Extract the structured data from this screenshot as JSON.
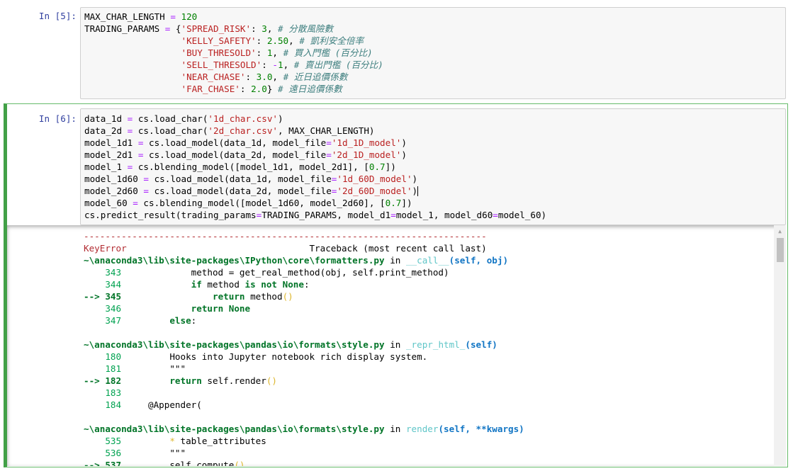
{
  "cells": [
    {
      "prompt": "In [5]:",
      "lines": [
        [
          [
            "",
            "MAX_CHAR_LENGTH "
          ],
          [
            "op",
            "="
          ],
          [
            "num",
            " 120"
          ]
        ],
        [
          [
            "",
            "TRADING_PARAMS "
          ],
          [
            "op",
            "="
          ],
          [
            "",
            " {"
          ],
          [
            "str",
            "'SPREAD_RISK'"
          ],
          [
            "",
            ": "
          ],
          [
            "num",
            "3"
          ],
          [
            "",
            ", "
          ],
          [
            "cmt",
            "# 分散風險數"
          ]
        ],
        [
          [
            "",
            "                  "
          ],
          [
            "str",
            "'KELLY_SAFETY'"
          ],
          [
            "",
            ": "
          ],
          [
            "num",
            "2.50"
          ],
          [
            "",
            ", "
          ],
          [
            "cmt",
            "# 凱利安全倍率"
          ]
        ],
        [
          [
            "",
            "                  "
          ],
          [
            "str",
            "'BUY_THRESOLD'"
          ],
          [
            "",
            ": "
          ],
          [
            "num",
            "1"
          ],
          [
            "",
            ", "
          ],
          [
            "cmt",
            "# 買入門檻 (百分比)"
          ]
        ],
        [
          [
            "",
            "                  "
          ],
          [
            "str",
            "'SELL_THRESOLD'"
          ],
          [
            "",
            ": "
          ],
          [
            "op",
            "-"
          ],
          [
            "num",
            "1"
          ],
          [
            "",
            ", "
          ],
          [
            "cmt",
            "# 賣出門檻 (百分比)"
          ]
        ],
        [
          [
            "",
            "                  "
          ],
          [
            "str",
            "'NEAR_CHASE'"
          ],
          [
            "",
            ": "
          ],
          [
            "num",
            "3.0"
          ],
          [
            "",
            ", "
          ],
          [
            "cmt",
            "# 近日追價係數"
          ]
        ],
        [
          [
            "",
            "                  "
          ],
          [
            "str",
            "'FAR_CHASE'"
          ],
          [
            "",
            ": "
          ],
          [
            "num",
            "2.0"
          ],
          [
            "",
            "} "
          ],
          [
            "cmt",
            "# 遠日追價係數"
          ]
        ]
      ]
    },
    {
      "prompt": "In [6]:",
      "lines": [
        [
          [
            "",
            "data_1d "
          ],
          [
            "op",
            "="
          ],
          [
            "",
            " cs.load_char("
          ],
          [
            "str",
            "'1d_char.csv'"
          ],
          [
            "",
            ")"
          ]
        ],
        [
          [
            "",
            "data_2d "
          ],
          [
            "op",
            "="
          ],
          [
            "",
            " cs.load_char("
          ],
          [
            "str",
            "'2d_char.csv'"
          ],
          [
            "",
            ", MAX_CHAR_LENGTH)"
          ]
        ],
        [
          [
            "",
            "model_1d1 "
          ],
          [
            "op",
            "="
          ],
          [
            "",
            " cs.load_model(data_1d, model_file"
          ],
          [
            "op",
            "="
          ],
          [
            "str",
            "'1d_1D_model'"
          ],
          [
            "",
            ")"
          ]
        ],
        [
          [
            "",
            "model_2d1 "
          ],
          [
            "op",
            "="
          ],
          [
            "",
            " cs.load_model(data_2d, model_file"
          ],
          [
            "op",
            "="
          ],
          [
            "str",
            "'2d_1D_model'"
          ],
          [
            "",
            ")"
          ]
        ],
        [
          [
            "",
            "model_1 "
          ],
          [
            "op",
            "="
          ],
          [
            "",
            " cs.blending_model([model_1d1, model_2d1], ["
          ],
          [
            "num",
            "0.7"
          ],
          [
            "",
            "])"
          ]
        ],
        [
          [
            "",
            "model_1d60 "
          ],
          [
            "op",
            "="
          ],
          [
            "",
            " cs.load_model(data_1d, model_file"
          ],
          [
            "op",
            "="
          ],
          [
            "str",
            "'1d_60D_model'"
          ],
          [
            "",
            ")"
          ]
        ],
        [
          [
            "",
            "model_2d60 "
          ],
          [
            "op",
            "="
          ],
          [
            "",
            " cs.load_model(data_2d, model_file"
          ],
          [
            "op",
            "="
          ],
          [
            "str",
            "'2d_60D_model'"
          ],
          [
            "",
            ")"
          ],
          [
            "cursor",
            ""
          ]
        ],
        [
          [
            "",
            "model_60 "
          ],
          [
            "op",
            "="
          ],
          [
            "",
            " cs.blending_model([model_1d60, model_2d60], ["
          ],
          [
            "num",
            "0.7"
          ],
          [
            "",
            "])"
          ]
        ],
        [
          [
            "",
            "cs.predict_result(trading_params"
          ],
          [
            "op",
            "="
          ],
          [
            "",
            "TRADING_PARAMS, model_d1"
          ],
          [
            "op",
            "="
          ],
          [
            "",
            "model_1, model_d60"
          ],
          [
            "op",
            "="
          ],
          [
            "",
            "model_60)"
          ]
        ]
      ]
    }
  ],
  "traceback": [
    [
      [
        "t-red",
        "---------------------------------------------------------------------------"
      ]
    ],
    [
      [
        "t-red",
        "KeyError"
      ],
      [
        "",
        "                                  Traceback (most recent call last)"
      ]
    ],
    [
      [
        "t-green-b",
        "~\\anaconda3\\lib\\site-packages\\IPython\\core\\formatters.py"
      ],
      [
        "",
        " in "
      ],
      [
        "t-cyan",
        "__call__"
      ],
      [
        "t-blue-b",
        "(self, obj)"
      ]
    ],
    [
      [
        "t-green",
        "    343"
      ],
      [
        "",
        "             method = get_real_method(obj, self.print_method)"
      ]
    ],
    [
      [
        "t-green",
        "    344"
      ],
      [
        "",
        "             "
      ],
      [
        "t-kw",
        "if"
      ],
      [
        "",
        " method "
      ],
      [
        "t-kw",
        "is"
      ],
      [
        "",
        " "
      ],
      [
        "t-kw",
        "not"
      ],
      [
        "",
        " "
      ],
      [
        "t-kw",
        "None"
      ],
      [
        "",
        ":"
      ]
    ],
    [
      [
        "t-green-b",
        "--> 345"
      ],
      [
        "",
        "                 "
      ],
      [
        "t-kw",
        "return"
      ],
      [
        "",
        " method"
      ],
      [
        "t-yellow",
        "()"
      ]
    ],
    [
      [
        "t-green",
        "    346"
      ],
      [
        "",
        "             "
      ],
      [
        "t-kw",
        "return"
      ],
      [
        "",
        " "
      ],
      [
        "t-kw",
        "None"
      ]
    ],
    [
      [
        "t-green",
        "    347"
      ],
      [
        "",
        "         "
      ],
      [
        "t-kw",
        "else"
      ],
      [
        "",
        ":"
      ]
    ],
    [
      [
        "",
        ""
      ]
    ],
    [
      [
        "t-green-b",
        "~\\anaconda3\\lib\\site-packages\\pandas\\io\\formats\\style.py"
      ],
      [
        "",
        " in "
      ],
      [
        "t-cyan",
        "_repr_html_"
      ],
      [
        "t-blue-b",
        "(self)"
      ]
    ],
    [
      [
        "t-green",
        "    180"
      ],
      [
        "",
        "         Hooks into Jupyter notebook rich display system."
      ]
    ],
    [
      [
        "t-green",
        "    181"
      ],
      [
        "",
        "         \"\"\""
      ]
    ],
    [
      [
        "t-green-b",
        "--> 182"
      ],
      [
        "",
        "         "
      ],
      [
        "t-kw",
        "return"
      ],
      [
        "",
        " self.render"
      ],
      [
        "t-yellow",
        "()"
      ]
    ],
    [
      [
        "t-green",
        "    183"
      ],
      [
        "",
        ""
      ]
    ],
    [
      [
        "t-green",
        "    184"
      ],
      [
        "",
        "     @Appender("
      ]
    ],
    [
      [
        "",
        ""
      ]
    ],
    [
      [
        "t-green-b",
        "~\\anaconda3\\lib\\site-packages\\pandas\\io\\formats\\style.py"
      ],
      [
        "",
        " in "
      ],
      [
        "t-cyan",
        "render"
      ],
      [
        "t-blue-b",
        "(self, **kwargs)"
      ]
    ],
    [
      [
        "t-green",
        "    535"
      ],
      [
        "",
        "         "
      ],
      [
        "t-yellow",
        "*"
      ],
      [
        "",
        " table_attributes"
      ]
    ],
    [
      [
        "t-green",
        "    536"
      ],
      [
        "",
        "         \"\"\""
      ]
    ],
    [
      [
        "t-green-b",
        "--> 537"
      ],
      [
        "",
        "         self.compute"
      ],
      [
        "t-yellow",
        "()"
      ]
    ]
  ],
  "scrollbar": {
    "up_arrow": "▲",
    "down_arrow": "▼"
  }
}
